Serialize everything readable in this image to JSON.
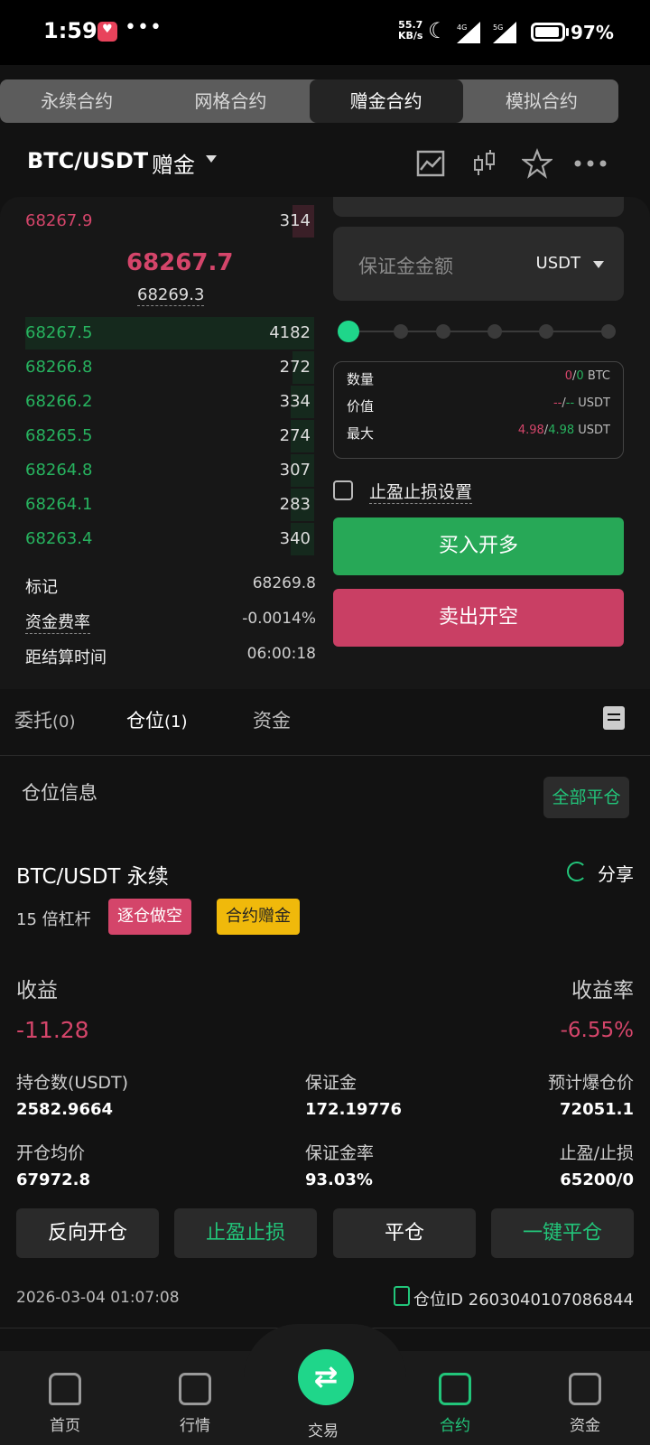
{
  "status_bar": {
    "time": "1:59",
    "net_speed_value": "55.7",
    "net_speed_unit": "KB/s",
    "signal_1": "4G",
    "signal_2": "5G",
    "battery": "97%"
  },
  "top_tabs": [
    {
      "label": "永续合约",
      "active": false
    },
    {
      "label": "网格合约",
      "active": false
    },
    {
      "label": "赠金合约",
      "active": true
    },
    {
      "label": "模拟合约",
      "active": false
    }
  ],
  "header": {
    "pair": "BTC/USDT",
    "tag": "赠金"
  },
  "orderbook": {
    "ask": {
      "price": "68267.9",
      "qty": "314"
    },
    "last_price": "68267.7",
    "index_price": "68269.3",
    "bids": [
      {
        "price": "68267.5",
        "qty": "4182"
      },
      {
        "price": "68266.8",
        "qty": "272"
      },
      {
        "price": "68266.2",
        "qty": "334"
      },
      {
        "price": "68265.5",
        "qty": "274"
      },
      {
        "price": "68264.8",
        "qty": "307"
      },
      {
        "price": "68264.1",
        "qty": "283"
      },
      {
        "price": "68263.4",
        "qty": "340"
      }
    ],
    "mark_label": "标记",
    "mark_value": "68269.8",
    "funding_label": "资金费率",
    "funding_value": "-0.0014%",
    "settle_label": "距结算时间",
    "settle_value": "06:00:18"
  },
  "order_form": {
    "margin_placeholder": "保证金金额",
    "margin_unit": "USDT",
    "slider_positions": [
      "0%",
      "20%",
      "40%",
      "60%",
      "80%",
      "100%"
    ],
    "slider_value": 0,
    "qty_label": "数量",
    "qty_a": "0",
    "qty_b": "0",
    "qty_unit": "BTC",
    "value_label": "价值",
    "value_a": "--",
    "value_b": "--",
    "value_unit": "USDT",
    "max_label": "最大",
    "max_a": "4.98",
    "max_b": "4.98",
    "max_unit": "USDT",
    "tpsl_label": "止盈止损设置",
    "buy_label": "买入开多",
    "sell_label": "卖出开空"
  },
  "order_tabs": [
    {
      "label": "委托",
      "count": "(0)"
    },
    {
      "label": "仓位",
      "count": "(1)"
    },
    {
      "label": "资金",
      "count": ""
    }
  ],
  "position": {
    "section_title": "仓位信息",
    "close_all": "全部平仓",
    "pair": "BTC/USDT 永续",
    "share": "分享",
    "leverage": "15 倍杠杆",
    "tag_mode": "逐仓做空",
    "tag_bonus": "合约赠金",
    "pnl_label": "收益",
    "pnl_rate_label": "收益率",
    "pnl": "-11.28",
    "pnl_rate": "-6.55%",
    "size_label": "持仓数(USDT)",
    "size": "2582.9664",
    "margin_label": "保证金",
    "margin": "172.19776",
    "liq_label": "预计爆仓价",
    "liq": "72051.1",
    "entry_label": "开仓均价",
    "entry": "67972.8",
    "margin_rate_label": "保证金率",
    "margin_rate": "93.03%",
    "tpsl_label": "止盈/止损",
    "tpsl": "65200/0",
    "btn_reverse": "反向开仓",
    "btn_tpsl": "止盈止损",
    "btn_close": "平仓",
    "btn_quick_close": "一键平仓",
    "time": "2026-03-04 01:07:08",
    "id_label": "仓位ID 2603040107086844"
  },
  "nav": {
    "home": "首页",
    "market": "行情",
    "trade": "交易",
    "futures": "合约",
    "assets": "资金"
  },
  "colors": {
    "red": "#d4456a",
    "green": "#27b35f",
    "accent": "#1fd68a",
    "yellow": "#f0b90b"
  }
}
